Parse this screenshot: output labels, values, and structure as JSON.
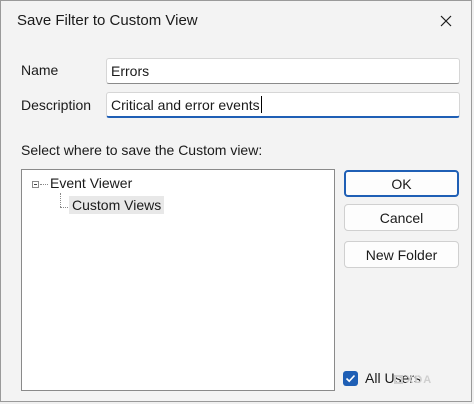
{
  "dialog": {
    "title": "Save Filter to Custom View"
  },
  "form": {
    "name_label": "Name",
    "name_value": "Errors",
    "description_label": "Description",
    "description_value": "Critical and error events",
    "location_label": "Select where to save the Custom view:"
  },
  "tree": {
    "root": "Event Viewer",
    "child": "Custom Views"
  },
  "buttons": {
    "ok": "OK",
    "cancel": "Cancel",
    "new_folder": "New Folder"
  },
  "options": {
    "all_users_label": "All Users",
    "all_users_checked": true
  },
  "watermark": {
    "text": "XDA"
  },
  "colors": {
    "accent": "#1f5fb5",
    "background": "#f3f3f3"
  }
}
